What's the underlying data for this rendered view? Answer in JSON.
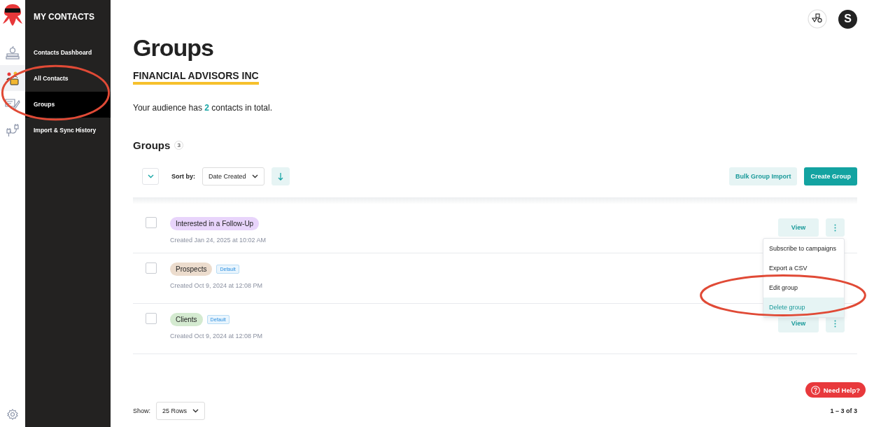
{
  "rail": {
    "items": [
      {
        "kind": "books",
        "selected": false
      },
      {
        "kind": "people",
        "selected": true
      },
      {
        "kind": "pen",
        "selected": false
      },
      {
        "kind": "plug",
        "selected": false
      }
    ]
  },
  "sidebar": {
    "title": "MY CONTACTS",
    "items": [
      {
        "label": "Contacts Dashboard",
        "selected": false
      },
      {
        "label": "All Contacts",
        "selected": false
      },
      {
        "label": "Groups",
        "selected": true
      },
      {
        "label": "Import & Sync History",
        "selected": false
      }
    ]
  },
  "header": {
    "avatar": "S"
  },
  "page": {
    "title": "Groups",
    "account": "FINANCIAL ADVISORS INC",
    "audience": "Your audience has **2** contacts in total."
  },
  "groups": {
    "heading": "Groups",
    "count": "3",
    "sort_label": "Sort by:",
    "sort_value": "Date Created",
    "bulk_button": "Bulk Group Import",
    "create_button": "Create Group",
    "rows": [
      {
        "name": "Interested in a Follow-Up",
        "color": "#e8d4fb",
        "default": "",
        "created": "Created Jan 24, 2025 at 10:02 AM",
        "checked": false,
        "view": "View",
        "more": true,
        "menu_open": true
      },
      {
        "name": "Prospects",
        "color": "#ecdccd",
        "default": "Default",
        "created": "Created Oct 9, 2024 at 12:08 PM",
        "checked": false,
        "view": "",
        "more": false,
        "menu_open": false
      },
      {
        "name": "Clients",
        "color": "#d4ead0",
        "default": "Default",
        "created": "Created Oct 9, 2024 at 12:08 PM",
        "checked": false,
        "view": "View",
        "more": true,
        "menu_open": false
      }
    ]
  },
  "menu": {
    "items": [
      {
        "label": "Subscribe to campaigns",
        "selected": false
      },
      {
        "label": "Export a CSV",
        "selected": false
      },
      {
        "label": "Edit group",
        "selected": false
      },
      {
        "label": "Delete group",
        "selected": true
      }
    ]
  },
  "footer": {
    "show_label": "Show:",
    "rows_value": "25 Rows",
    "range": "1 – 3 of 3"
  },
  "help": {
    "label": "Need Help?"
  },
  "annotations": [
    {
      "kind": "ellipse",
      "color": "#e04a36"
    },
    {
      "kind": "ellipse",
      "color": "#e04a36"
    }
  ]
}
